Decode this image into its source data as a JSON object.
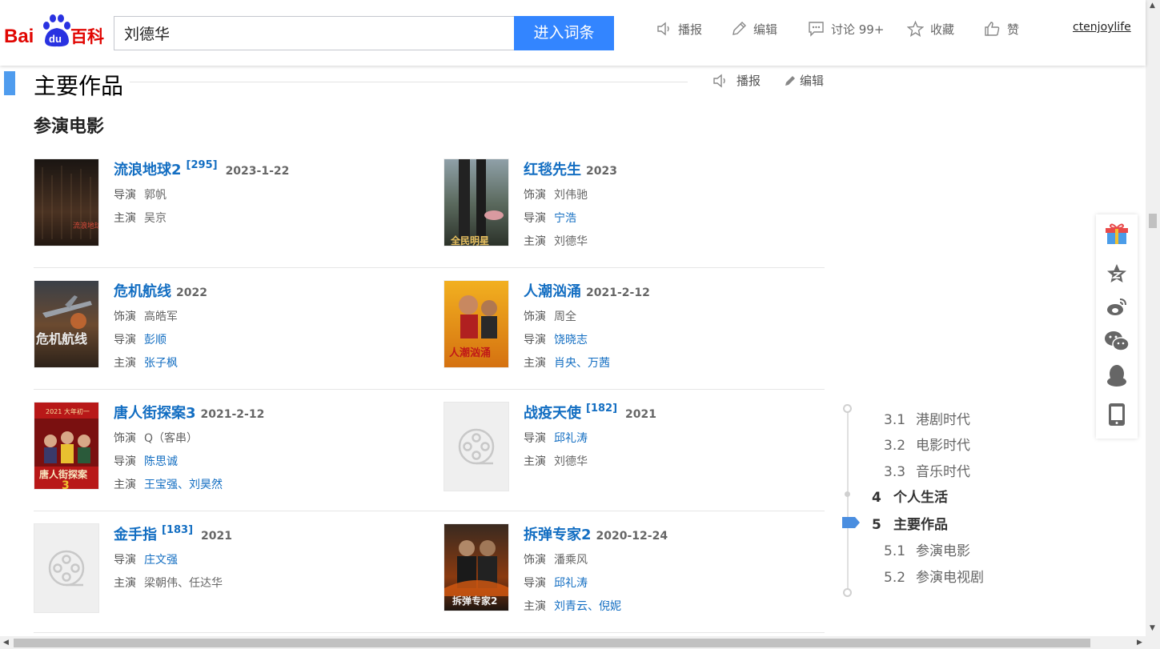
{
  "header": {
    "logo_text": "Bai du 百科",
    "search_value": "刘德华",
    "enter_button": "进入词条",
    "actions": [
      {
        "label": "播报",
        "icon": "speaker-icon"
      },
      {
        "label": "编辑",
        "icon": "pencil-icon"
      },
      {
        "label": "讨论 99+",
        "icon": "comment-icon"
      },
      {
        "label": "收藏",
        "icon": "star-icon"
      },
      {
        "label": "赞",
        "icon": "thumbs-up-icon"
      }
    ],
    "user": "ctenjoylife"
  },
  "section": {
    "title": "主要作品",
    "broadcast": "播报",
    "edit": "编辑",
    "subsection": "参演电影"
  },
  "movies": [
    {
      "title": "流浪地球2",
      "ref": "[295]",
      "date": "2023-1-22",
      "rows": [
        {
          "label": "导演",
          "value": "郭帆",
          "link": false
        },
        {
          "label": "主演",
          "value": "吴京",
          "link": false
        }
      ]
    },
    {
      "title": "红毯先生",
      "ref": "",
      "date": "2023",
      "rows": [
        {
          "label": "饰演",
          "value": "刘伟驰",
          "link": false
        },
        {
          "label": "导演",
          "value": "宁浩",
          "link": true
        },
        {
          "label": "主演",
          "value": "刘德华",
          "link": false
        }
      ]
    },
    {
      "title": "危机航线",
      "ref": "",
      "date": "2022",
      "rows": [
        {
          "label": "饰演",
          "value": "高皓军",
          "link": false
        },
        {
          "label": "导演",
          "value": "彭顺",
          "link": true
        },
        {
          "label": "主演",
          "value": "张子枫",
          "link": true
        }
      ]
    },
    {
      "title": "人潮汹涌",
      "ref": "",
      "date": "2021-2-12",
      "rows": [
        {
          "label": "饰演",
          "value": "周全",
          "link": false
        },
        {
          "label": "导演",
          "value": "饶晓志",
          "link": true
        },
        {
          "label": "主演",
          "value": "肖央、万茜",
          "link": true
        }
      ]
    },
    {
      "title": "唐人街探案3",
      "ref": "",
      "date": "2021-2-12",
      "rows": [
        {
          "label": "饰演",
          "value": "Q（客串）",
          "link": false
        },
        {
          "label": "导演",
          "value": "陈思诚",
          "link": true
        },
        {
          "label": "主演",
          "value": "王宝强、刘昊然",
          "link": true
        }
      ]
    },
    {
      "title": "战疫天使",
      "ref": "[182]",
      "date": "2021",
      "rows": [
        {
          "label": "导演",
          "value": "邱礼涛",
          "link": true
        },
        {
          "label": "主演",
          "value": "刘德华",
          "link": false
        }
      ]
    },
    {
      "title": "金手指",
      "ref": "[183]",
      "date": "2021",
      "rows": [
        {
          "label": "导演",
          "value": "庄文强",
          "link": true
        },
        {
          "label": "主演",
          "value": "梁朝伟、任达华",
          "link": false
        }
      ]
    },
    {
      "title": "拆弹专家2",
      "ref": "",
      "date": "2020-12-24",
      "rows": [
        {
          "label": "饰演",
          "value": "潘乘风",
          "link": false
        },
        {
          "label": "导演",
          "value": "邱礼涛",
          "link": true
        },
        {
          "label": "主演",
          "value": "刘青云、倪妮",
          "link": true
        }
      ]
    }
  ],
  "poster_texts": {
    "p1": "流浪地球",
    "p2": "全民明星",
    "p3": "危机航线",
    "p4": "人潮汹涌",
    "p5": "唐人街探案",
    "p5b": "3",
    "p5c": "2021 大年初一",
    "p8": "拆弹专家2"
  },
  "toc": [
    {
      "num": "3.1",
      "label": "港剧时代",
      "level": 2
    },
    {
      "num": "3.2",
      "label": "电影时代",
      "level": 2
    },
    {
      "num": "3.3",
      "label": "音乐时代",
      "level": 2
    },
    {
      "num": "4",
      "label": "个人生活",
      "level": 1
    },
    {
      "num": "5",
      "label": "主要作品",
      "level": 1,
      "active": true
    },
    {
      "num": "5.1",
      "label": "参演电影",
      "level": 2
    },
    {
      "num": "5.2",
      "label": "参演电视剧",
      "level": 2
    }
  ],
  "share_icons": [
    "gift-icon",
    "favorite-star-icon",
    "weibo-icon",
    "wechat-icon",
    "qq-icon",
    "mobile-icon"
  ],
  "colors": {
    "accent": "#3385ff",
    "link": "#136ec2",
    "section_bar": "#4f9cee",
    "logo_red": "#e10602",
    "logo_blue": "#2932e1"
  }
}
